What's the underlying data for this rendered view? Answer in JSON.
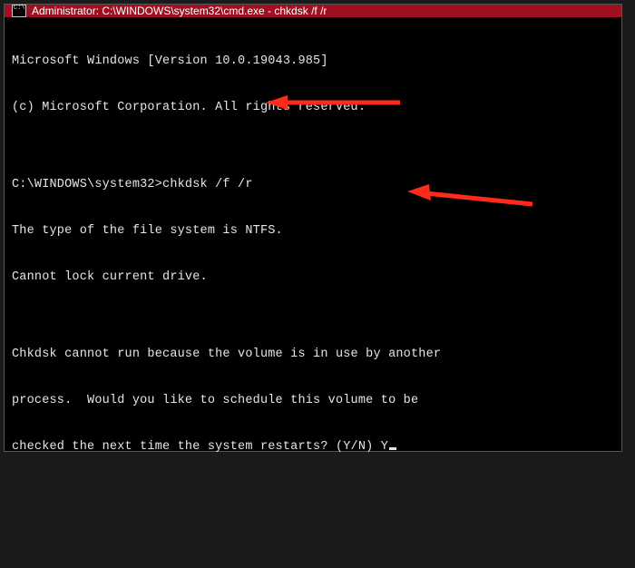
{
  "titlebar": {
    "title": "Administrator: C:\\WINDOWS\\system32\\cmd.exe - chkdsk  /f /r"
  },
  "terminal": {
    "line1": "Microsoft Windows [Version 10.0.19043.985]",
    "line2": "(c) Microsoft Corporation. All rights reserved.",
    "blank1": "",
    "prompt_line": "C:\\WINDOWS\\system32>chkdsk /f /r",
    "fs_line": "The type of the file system is NTFS.",
    "lock_line": "Cannot lock current drive.",
    "blank2": "",
    "msg1": "Chkdsk cannot run because the volume is in use by another",
    "msg2": "process.  Would you like to schedule this volume to be",
    "msg3_prefix": "checked the next time the system restarts? (Y/N) ",
    "user_input": "Y"
  },
  "colors": {
    "arrow": "#ff2a1a",
    "titlebar_bg": "#a01020",
    "terminal_bg": "#000000",
    "terminal_fg": "#e6e6e6"
  }
}
